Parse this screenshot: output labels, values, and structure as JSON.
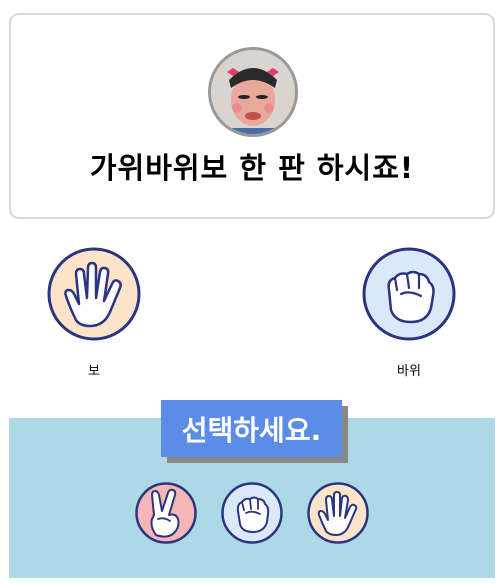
{
  "header": {
    "title": "가위바위보 한 판 하시죠!",
    "avatar_icon": "opponent-avatar-photo"
  },
  "opponent_hand": {
    "label": "보",
    "icon": "paper-hand-icon"
  },
  "player_hand": {
    "label": "바위",
    "icon": "rock-hand-icon"
  },
  "choose": {
    "banner": "선택하세요.",
    "options": [
      {
        "id": "scissors",
        "icon": "scissors-hand-icon",
        "color": "#f4b6b6"
      },
      {
        "id": "rock",
        "icon": "rock-hand-icon",
        "color": "#dbe8f9"
      },
      {
        "id": "paper",
        "icon": "paper-hand-icon",
        "color": "#fde3c8"
      }
    ]
  },
  "colors": {
    "outline": "#2b3480",
    "panel": "#add8e6",
    "banner": "#5b8ce6"
  }
}
